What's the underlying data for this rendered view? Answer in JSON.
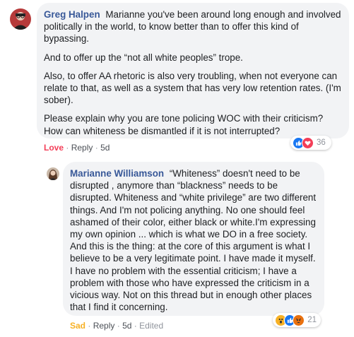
{
  "comments": [
    {
      "author": "Greg Halpen",
      "paragraphs": [
        "Marianne you've been around long enough and involved politically in the world, to know better than to offer this kind of bypassing.",
        "And to offer up the “not all white peoples” trope.",
        "Also, to offer AA rhetoric is also very troubling, when not everyone can relate to that, as well as a system that has very low retention rates. (I'm sober).",
        "Please explain why you are tone policing WOC with their criticism? How can whiteness be dismantled if it is not interrupted?"
      ],
      "reaction_label": "Love",
      "reply_label": "Reply",
      "time": "5d",
      "reactions": [
        "like-icon",
        "love-icon"
      ],
      "reaction_count": "36"
    },
    {
      "author": "Marianne Williamson",
      "paragraphs": [
        "“Whiteness” doesn't need to be disrupted , anymore than “blackness” needs to be disrupted. Whiteness and “white privilege” are two different things. And I'm not policing anything. No one should feel ashamed of their color, either black or white.I'm expressing my own opinion ... which is what we DO in a free society. And this is the thing: at the core of this argument is what I believe to be a very legitimate point. I have made it myself. I have no problem with the essential criticism; I have a problem with those who have expressed the criticism in a vicious way. Not on this thread but in enough other places that I find it concerning."
      ],
      "reaction_label": "Sad",
      "reply_label": "Reply",
      "time": "5d",
      "edited": "Edited",
      "reactions": [
        "wow-icon",
        "like-icon",
        "angry-icon"
      ],
      "reaction_count": "21"
    }
  ],
  "colors": {
    "name": "#385898",
    "bubble": "#f2f3f5",
    "love": "#f33e58",
    "sad": "#f7b125",
    "like": "#1877f2"
  }
}
